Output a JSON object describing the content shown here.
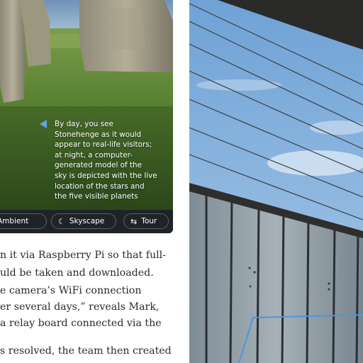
{
  "screenshot": {
    "caption": "By day, you see Stonehenge as it would appear to real-life visitors; at night, a computer-generated model of the sky is depicted with the live location of the stars and the five visible planets",
    "caption_lines": [
      "By day, you see",
      "Stonehenge as it would",
      "appear to real-life visitors;",
      "at night, a computer-",
      "generated model of the",
      "sky is depicted with the live",
      "location of the stars and",
      "the five visible planets"
    ],
    "toolbar": {
      "buttons": [
        {
          "label": "Ambient",
          "icon": "ambient-icon"
        },
        {
          "label": "Skyscape",
          "icon": "moon-star-icon"
        },
        {
          "label": "Tour",
          "icon": "signpost-icon"
        }
      ]
    },
    "colors": {
      "accent": "#5aa9e6",
      "toolbar": "#1f2326"
    }
  },
  "article": {
    "lines": [
      "n it via Raspberry Pi so that full-",
      "uld be taken and downloaded.",
      "e camera’s WiFi connection",
      "er several days,” reveals Mark,",
      "a relay board connected via the",
      "",
      "s resolved, the team then created"
    ]
  }
}
